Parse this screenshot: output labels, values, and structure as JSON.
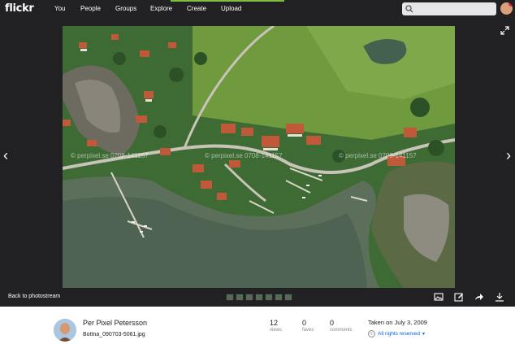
{
  "nav": {
    "logo": "flickr",
    "links": [
      "You",
      "People",
      "Groups",
      "Explore",
      "Create",
      "Upload"
    ],
    "icons": [
      "search-icon",
      "avatar"
    ]
  },
  "viewer": {
    "back_label": "Back to photostream",
    "watermark": "© perpixel.se 0708-141157",
    "icons": [
      "chevron-left-icon",
      "chevron-right-icon",
      "expand-icon",
      "image-icon",
      "edit-icon",
      "share-icon",
      "download-icon"
    ]
  },
  "photo_info": {
    "owner_name": "Per Pixel Petersson",
    "filename": "Bottna_090703-5061.jpg",
    "stats": [
      {
        "value": "12",
        "label": "views"
      },
      {
        "value": "0",
        "label": "faves"
      },
      {
        "value": "0",
        "label": "comments"
      }
    ],
    "taken": "Taken on July 3, 2009",
    "rights": "All rights reserved",
    "colors": {
      "accent": "#0063dc",
      "nav_bg": "#212124"
    }
  }
}
